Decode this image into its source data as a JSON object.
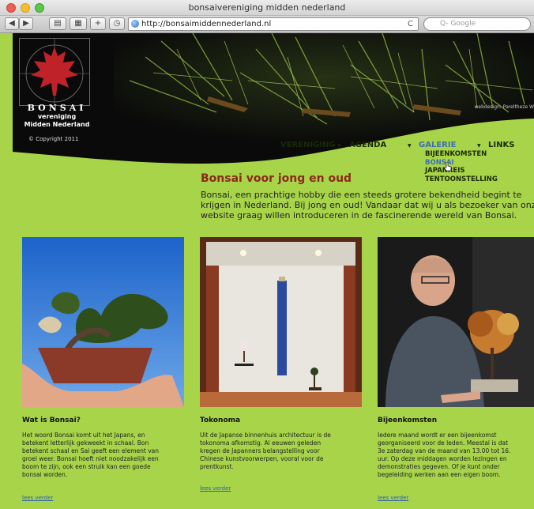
{
  "browser": {
    "window_title": "bonsaivereniging midden nederland",
    "url": "http://bonsaimiddennederland.nl",
    "search_placeholder": "Q- Google",
    "reload_glyph": "C"
  },
  "header": {
    "logo_title": "BONSAI",
    "logo_line1": "vereniging",
    "logo_line2": "Midden Nederland",
    "copyright": "© Copyright 2011",
    "webdesign": "webdesign: Pareltheze W"
  },
  "nav": {
    "items": [
      {
        "label": "VERENIGING"
      },
      {
        "label": "AGENDA"
      },
      {
        "label": "GALERIE"
      },
      {
        "label": "LINKS"
      }
    ],
    "submenu": [
      "BIJEENKOMSTEN",
      "BONSAI",
      "JAPANREIS",
      "TENTOONSTELLING"
    ]
  },
  "main": {
    "headline": "Bonsai voor jong en oud",
    "intro_lines": [
      "Bonsai, een prachtige hobby die een steeds grotere bekendheid begint te",
      "krijgen in Nederland. Bij jong en oud! Vandaar dat wij u als bezoeker van onze",
      "website graag willen introduceren in de fascinerende wereld van Bonsai."
    ]
  },
  "columns": [
    {
      "title": "Wat is Bonsai?",
      "lines": [
        "Het woord Bonsai komt uit het Japans, en",
        "betekent letterlijk gekweekt in schaal. Bon",
        "betekent schaal en Sai geeft een element van",
        "groei weer. Bonsai hoeft niet noodzakelijk een",
        "boom te zijn, ook een struik kan een goede",
        "bonsai worden."
      ],
      "more": "lees verder"
    },
    {
      "title": "Tokonoma",
      "lines": [
        "Uit de Japanse binnenhuis architectuur is de",
        "tokonoma afkomstig. Al eeuwen geleden",
        "kregen de Japanners belangstelling voor",
        "Chinese kunstvoorwerpen, vooral voor de",
        "prentkunst."
      ],
      "more": "lees verder"
    },
    {
      "title": "Bijeenkomsten",
      "lines": [
        "Iedere maand wordt er een bijeenkomst",
        "georganiseerd voor de leden. Meestal is dat",
        "3e zaterdag van de maand van 13.00 tot 16.",
        "uur. Op deze middagen worden lezingen en",
        "demonstraties gegeven. Of je kunt onder",
        "begeleiding werken aan een eigen boom."
      ],
      "more": "lees verder"
    }
  ],
  "colors": {
    "page_green": "#a8d44a",
    "headline_red": "#8b2a1a",
    "link_blue": "#2a5db0"
  }
}
